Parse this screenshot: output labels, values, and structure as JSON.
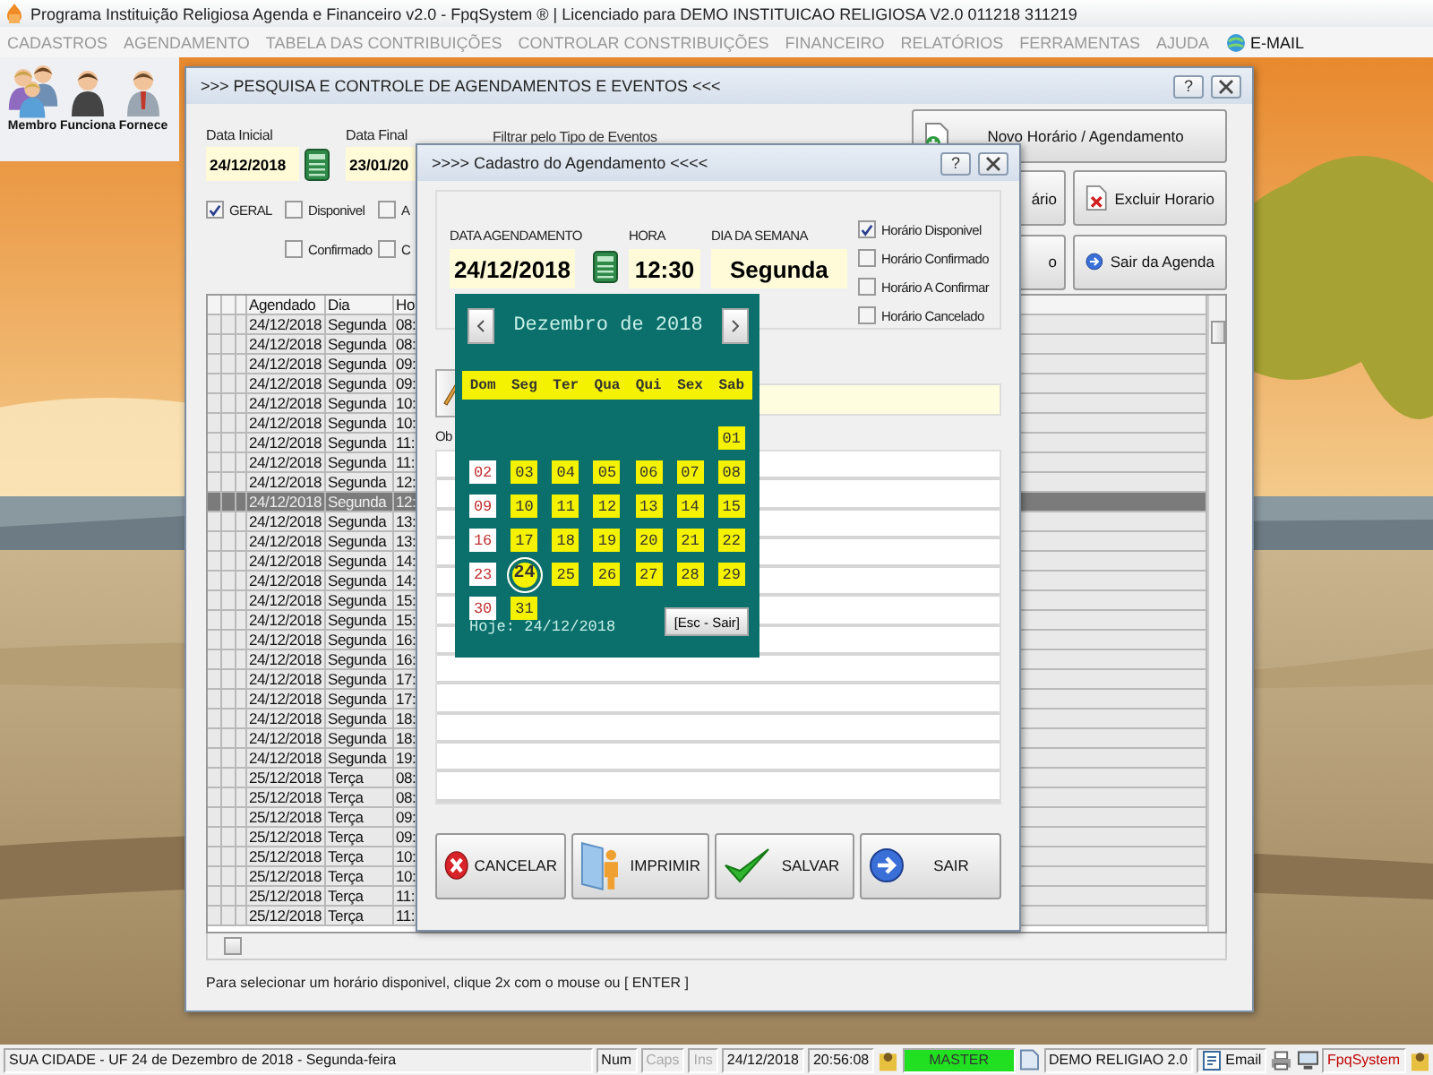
{
  "app": {
    "title": "Programa Instituição Religiosa Agenda e Financeiro v2.0 - FpqSystem ® | Licenciado para  DEMO INSTITUICAO RELIGIOSA V2.0 011218 311219"
  },
  "menu": [
    "CADASTROS",
    "AGENDAMENTO",
    "TABELA DAS CONTRIBUIÇÕES",
    "CONTROLAR CONSTRIBUIÇÕES",
    "FINANCEIRO",
    "RELATÓRIOS",
    "FERRAMENTAS",
    "AJUDA"
  ],
  "menu_email": "E-MAIL",
  "toolbar": [
    {
      "label": "Membro",
      "kind": "group"
    },
    {
      "label": "Funciona",
      "kind": "woman"
    },
    {
      "label": "Fornece",
      "kind": "man"
    }
  ],
  "main_window": {
    "title": ">>>  PESQUISA E CONTROLE DE AGENDAMENTOS E EVENTOS  <<<",
    "help": "?",
    "start_label": "Data Inicial",
    "start_value": "24/12/2018",
    "end_label": "Data Final",
    "end_value": "23/01/20",
    "filter_label": "Filtrar pelo Tipo de Eventos",
    "filter_rows": [
      {
        "kind": "full",
        "items": [
          {
            "label": "GERAL",
            "checked": true
          },
          {
            "label": "Disponivel",
            "checked": false
          },
          {
            "label": "A",
            "checked": false
          }
        ]
      },
      {
        "kind": "trailing",
        "items": [
          {
            "label": "Confirmado",
            "checked": false
          },
          {
            "label": "C",
            "checked": false
          }
        ]
      }
    ],
    "buttons": [
      {
        "label": "Novo Horário / Agendamento",
        "kind": "new"
      },
      {
        "label": "ário",
        "kind": "cut"
      },
      {
        "label": "Excluir Horario",
        "kind": "delete"
      },
      {
        "label": "o",
        "kind": "cut"
      },
      {
        "label": "Sair da Agenda",
        "kind": "exit"
      }
    ],
    "columns": [
      "Agendado",
      "Dia",
      "Ho"
    ],
    "rows": [
      {
        "date": "24/12/2018",
        "day": "Segunda",
        "hour": "08:",
        "selected": false
      },
      {
        "date": "24/12/2018",
        "day": "Segunda",
        "hour": "08:",
        "selected": false
      },
      {
        "date": "24/12/2018",
        "day": "Segunda",
        "hour": "09:",
        "selected": false
      },
      {
        "date": "24/12/2018",
        "day": "Segunda",
        "hour": "09:",
        "selected": false
      },
      {
        "date": "24/12/2018",
        "day": "Segunda",
        "hour": "10:",
        "selected": false
      },
      {
        "date": "24/12/2018",
        "day": "Segunda",
        "hour": "10:",
        "selected": false
      },
      {
        "date": "24/12/2018",
        "day": "Segunda",
        "hour": "11:",
        "selected": false
      },
      {
        "date": "24/12/2018",
        "day": "Segunda",
        "hour": "11:",
        "selected": false
      },
      {
        "date": "24/12/2018",
        "day": "Segunda",
        "hour": "12:",
        "selected": false
      },
      {
        "date": "24/12/2018",
        "day": "Segunda",
        "hour": "12:",
        "selected": true
      },
      {
        "date": "24/12/2018",
        "day": "Segunda",
        "hour": "13:",
        "selected": false
      },
      {
        "date": "24/12/2018",
        "day": "Segunda",
        "hour": "13:",
        "selected": false
      },
      {
        "date": "24/12/2018",
        "day": "Segunda",
        "hour": "14:",
        "selected": false
      },
      {
        "date": "24/12/2018",
        "day": "Segunda",
        "hour": "14:",
        "selected": false
      },
      {
        "date": "24/12/2018",
        "day": "Segunda",
        "hour": "15:",
        "selected": false
      },
      {
        "date": "24/12/2018",
        "day": "Segunda",
        "hour": "15:",
        "selected": false
      },
      {
        "date": "24/12/2018",
        "day": "Segunda",
        "hour": "16:",
        "selected": false
      },
      {
        "date": "24/12/2018",
        "day": "Segunda",
        "hour": "16:",
        "selected": false
      },
      {
        "date": "24/12/2018",
        "day": "Segunda",
        "hour": "17:",
        "selected": false
      },
      {
        "date": "24/12/2018",
        "day": "Segunda",
        "hour": "17:",
        "selected": false
      },
      {
        "date": "24/12/2018",
        "day": "Segunda",
        "hour": "18:",
        "selected": false
      },
      {
        "date": "24/12/2018",
        "day": "Segunda",
        "hour": "18:",
        "selected": false
      },
      {
        "date": "24/12/2018",
        "day": "Segunda",
        "hour": "19:",
        "selected": false
      },
      {
        "date": "25/12/2018",
        "day": "Terça",
        "hour": "08:",
        "selected": false
      },
      {
        "date": "25/12/2018",
        "day": "Terça",
        "hour": "08:",
        "selected": false
      },
      {
        "date": "25/12/2018",
        "day": "Terça",
        "hour": "09:",
        "selected": false
      },
      {
        "date": "25/12/2018",
        "day": "Terça",
        "hour": "09:",
        "selected": false
      },
      {
        "date": "25/12/2018",
        "day": "Terça",
        "hour": "10:",
        "selected": false
      },
      {
        "date": "25/12/2018",
        "day": "Terça",
        "hour": "10:",
        "selected": false
      },
      {
        "date": "25/12/2018",
        "day": "Terça",
        "hour": "11:",
        "selected": false
      },
      {
        "date": "25/12/2018",
        "day": "Terça",
        "hour": "11:",
        "selected": false
      }
    ],
    "hint": "Para selecionar um horário disponivel, clique 2x com o mouse ou [ ENTER ]"
  },
  "dialog": {
    "title": ">>>>  Cadastro do Agendamento  <<<<",
    "help": "?",
    "date_label": "DATA AGENDAMENTO",
    "date_value": "24/12/2018",
    "hour_label": "HORA",
    "hour_value": "12:30",
    "weekday_label": "DIA DA SEMANA",
    "weekday_value": "Segunda",
    "statuses": [
      {
        "label": "Horário Disponivel",
        "checked": true
      },
      {
        "label": "Horário Confirmado",
        "checked": false
      },
      {
        "label": "Horário A Confirmar",
        "checked": false
      },
      {
        "label": "Horário Cancelado",
        "checked": false
      }
    ],
    "obs_label": "Ob",
    "buttons": [
      {
        "label": "CANCELAR",
        "kind": "cancel"
      },
      {
        "label": "IMPRIMIR",
        "kind": "print"
      },
      {
        "label": "SALVAR",
        "kind": "save"
      },
      {
        "label": "SAIR",
        "kind": "exit"
      }
    ]
  },
  "calendar": {
    "month": "Dezembro de 2018",
    "weekdays": [
      "Dom",
      "Seg",
      "Ter",
      "Qua",
      "Qui",
      "Sex",
      "Sab"
    ],
    "weeks": [
      {
        "kind": "trailing",
        "days": [
          {
            "label": "01",
            "selected": false
          }
        ]
      },
      {
        "kind": "full",
        "days": [
          {
            "label": "02",
            "selected": false
          },
          {
            "label": "03",
            "selected": false
          },
          {
            "label": "04",
            "selected": false
          },
          {
            "label": "05",
            "selected": false
          },
          {
            "label": "06",
            "selected": false
          },
          {
            "label": "07",
            "selected": false
          },
          {
            "label": "08",
            "selected": false
          }
        ]
      },
      {
        "kind": "full",
        "days": [
          {
            "label": "09",
            "selected": false
          },
          {
            "label": "10",
            "selected": false
          },
          {
            "label": "11",
            "selected": false
          },
          {
            "label": "12",
            "selected": false
          },
          {
            "label": "13",
            "selected": false
          },
          {
            "label": "14",
            "selected": false
          },
          {
            "label": "15",
            "selected": false
          }
        ]
      },
      {
        "kind": "full",
        "days": [
          {
            "label": "16",
            "selected": false
          },
          {
            "label": "17",
            "selected": false
          },
          {
            "label": "18",
            "selected": false
          },
          {
            "label": "19",
            "selected": false
          },
          {
            "label": "20",
            "selected": false
          },
          {
            "label": "21",
            "selected": false
          },
          {
            "label": "22",
            "selected": false
          }
        ]
      },
      {
        "kind": "full",
        "days": [
          {
            "label": "23",
            "selected": false
          },
          {
            "label": "24",
            "selected": true
          },
          {
            "label": "25",
            "selected": false
          },
          {
            "label": "26",
            "selected": false
          },
          {
            "label": "27",
            "selected": false
          },
          {
            "label": "28",
            "selected": false
          },
          {
            "label": "29",
            "selected": false
          }
        ]
      },
      {
        "kind": "full",
        "days": [
          {
            "label": "30",
            "selected": false
          },
          {
            "label": "31",
            "selected": false
          }
        ]
      }
    ],
    "today": "Hoje: 24/12/2018",
    "close": "[Esc - Sair]"
  },
  "status_bar": {
    "location": "SUA CIDADE - UF 24 de Dezembro de 2018 - Segunda-feira",
    "keys": [
      {
        "label": "Num",
        "disabled": false
      },
      {
        "label": "Caps",
        "disabled": true
      },
      {
        "label": "Ins",
        "disabled": true
      }
    ],
    "date": "24/12/2018",
    "time": "20:56:08",
    "user": "MASTER",
    "company": "DEMO RELIGIAO 2.0",
    "email": "Email",
    "brand": "FpqSystem"
  }
}
